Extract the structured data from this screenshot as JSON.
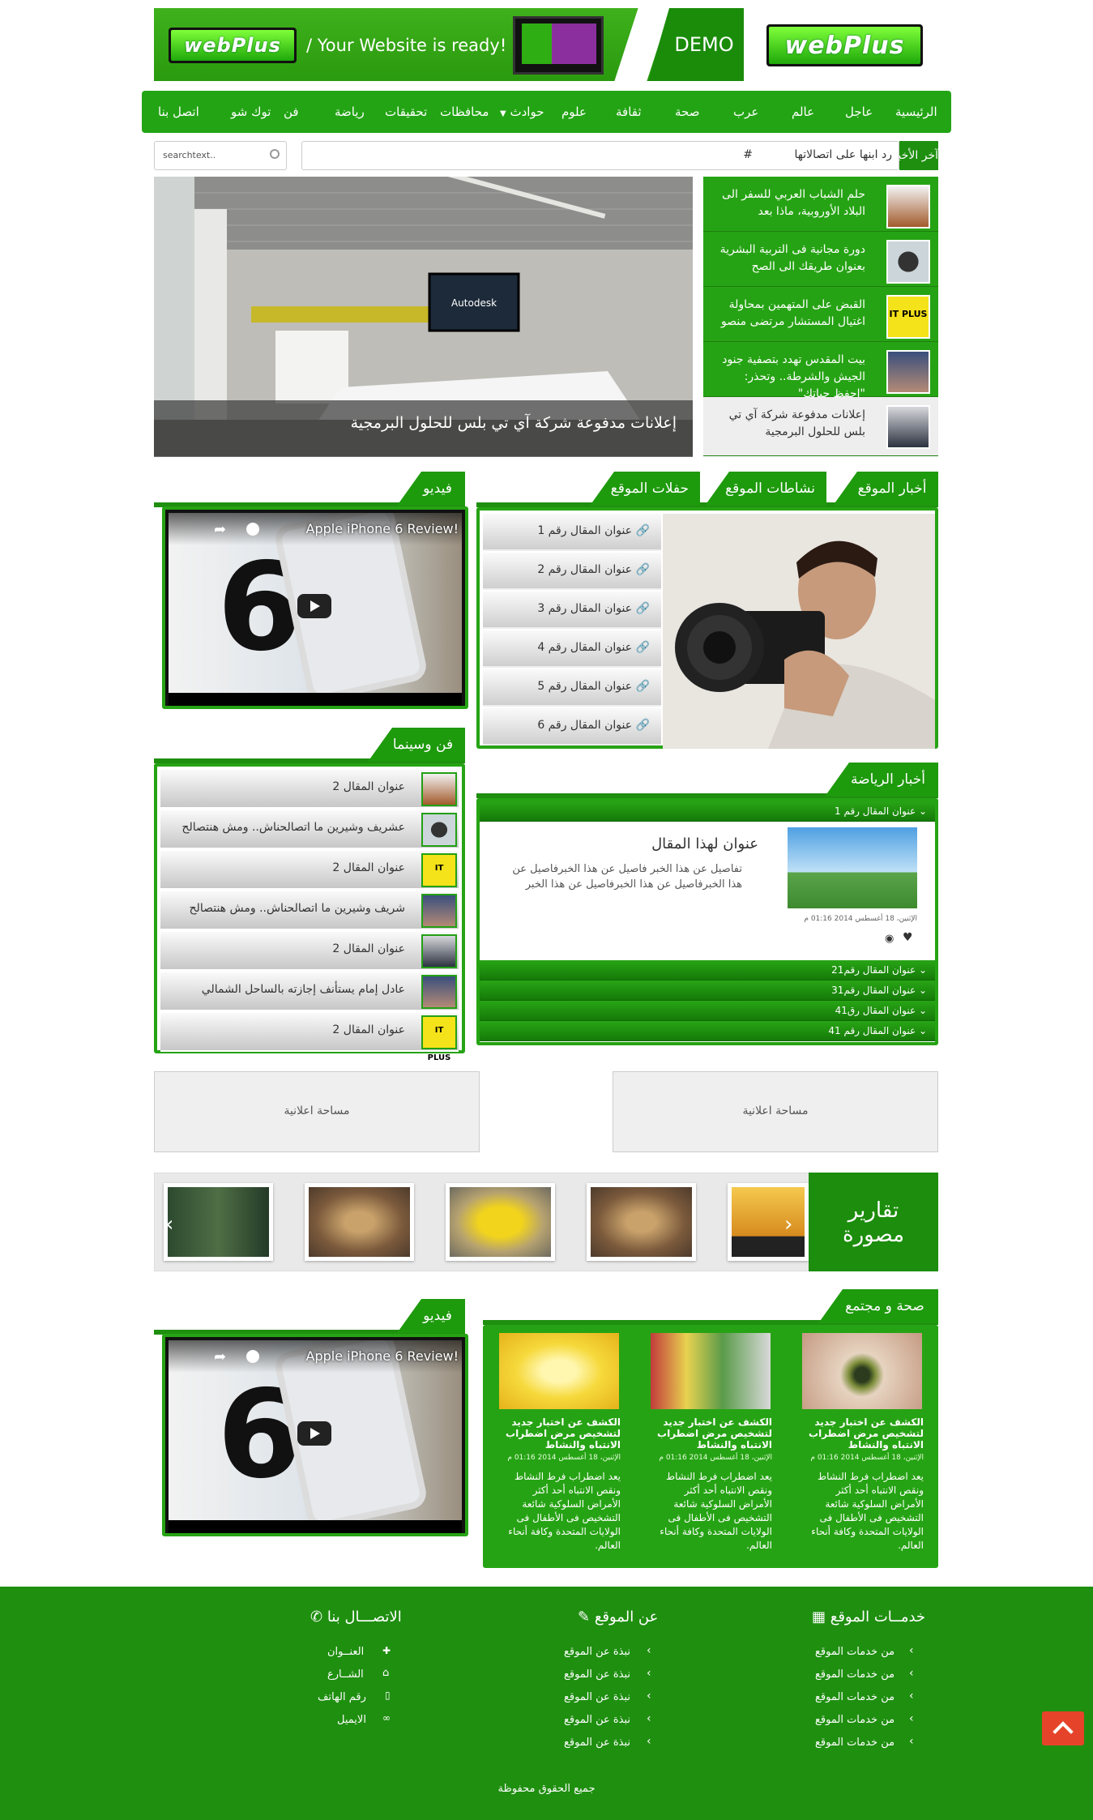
{
  "header": {
    "logo_text": "webPlus",
    "tagline": "/ Your Website is ready!",
    "demo_label": "DEMO"
  },
  "nav": {
    "items": [
      "الرئيسية",
      "عاجل",
      "عالم",
      "عرب",
      "صحة",
      "ثقافة",
      "علوم",
      "حوادث",
      "محافظات",
      "تحقيقات",
      "رياضة",
      "فن",
      "توك شو",
      "اتصل بنا"
    ]
  },
  "ticker": {
    "label": "آخر الأخبار",
    "text": "رد ابنها على اتصالاتها",
    "hash": "#"
  },
  "search": {
    "placeholder": "searchtext.."
  },
  "slider": {
    "caption": "إعلانات مدفوعة شركة آي تي بلس للحلول البرمجية",
    "image_text": "Autodesk",
    "items": [
      "حلم الشباب العربي للسفر الى البلاد الأوروبية، ماذا بعد",
      "دورة مجانية فى التربية البشرية بعنوان طريقك الى الصح",
      "القبض على المتهمين بمحاولة اغتيال المستشار مرتضى منصو",
      "بيت المقدس تهدد بتصفية جنود الجيش والشرطة.. وتحذر: \"احفظ حياتك\"",
      "إعلانات مدفوعة شركة آي تي بلس للحلول البرمجية"
    ]
  },
  "tabs": {
    "site_news": "أخبار الموقع",
    "site_activities": "نشاطات الموقع",
    "site_events": "حفلات الموقع",
    "video": "فيديو",
    "art_cinema": "فن وسينما",
    "sports_news": "أخبار الرياضة",
    "health_society": "صحة و مجتمع"
  },
  "articles": [
    "عنوان المقال رقم 1",
    "عنوان المقال رقم 2",
    "عنوان المقال رقم 3",
    "عنوان المقال رقم 4",
    "عنوان المقال رقم 5",
    "عنوان المقال رقم 6"
  ],
  "video": {
    "title": "Apple iPhone 6 Review!"
  },
  "art_list": [
    "عنوان المقال 2",
    "عشريف وشيرين ما اتصالحناش.. ومش هنتصالح",
    "عنوان المقال 2",
    "شريف وشيرين ما اتصالحناش.. ومش هنتصالح",
    "عنوان المقال 2",
    "عادل إمام يستأنف إجازته بالساحل الشمالي",
    "عنوان المقال 2"
  ],
  "sports": {
    "first_bar": "عنوان المقال رقم 1",
    "headline": "عنوان لهذا المقال",
    "body": "تفاصيل عن هذا الخبر فاصيل عن هذا الخبرفاصيل عن هذا الخبرفاصيل عن هذا الخبرفاصيل عن هذا الخبر",
    "date": "الإثنين، 18 أغسطس 2014 01:16 م",
    "bars": [
      "عنوان المقال رقم21",
      "عنوان المقال رقم31",
      "عنوان المقال رق41",
      "عنوان المقال رقم 41"
    ]
  },
  "ads": {
    "label": "مساحة اعلانية"
  },
  "gallery": {
    "label_line1": "تقارير",
    "label_line2": "مصورة"
  },
  "health": {
    "title": "الكشف عن اختبار جديد لتشخيص مرض اضطراب الانتباه والنشاط",
    "date": "الإثنين، 18 أغسطس 2014 01:16 م",
    "body": "يعد اضطراب فرط النشاط ونقص الانتباه أحد أكثر الأمراض السلوكية شائعة التشخيص فى الأطفال فى الولايات المتحدة وكافة أنحاء العالم."
  },
  "footer": {
    "services_heading": "خدمــات الموقع",
    "services_link": "من خدمات الموقع",
    "about_heading": "عن الموقع",
    "about_link": "نبذة عن الموقع",
    "contact_heading": "الاتصـــال بنا",
    "contact_items": [
      "العنــوان",
      "الشــارع",
      "رقم الهاتف",
      "الايميل"
    ],
    "copyright": "جميع الحقوق محفوظة"
  },
  "colors": {
    "brand_green": "#1f8f10",
    "scroll_top": "#e5442a"
  }
}
